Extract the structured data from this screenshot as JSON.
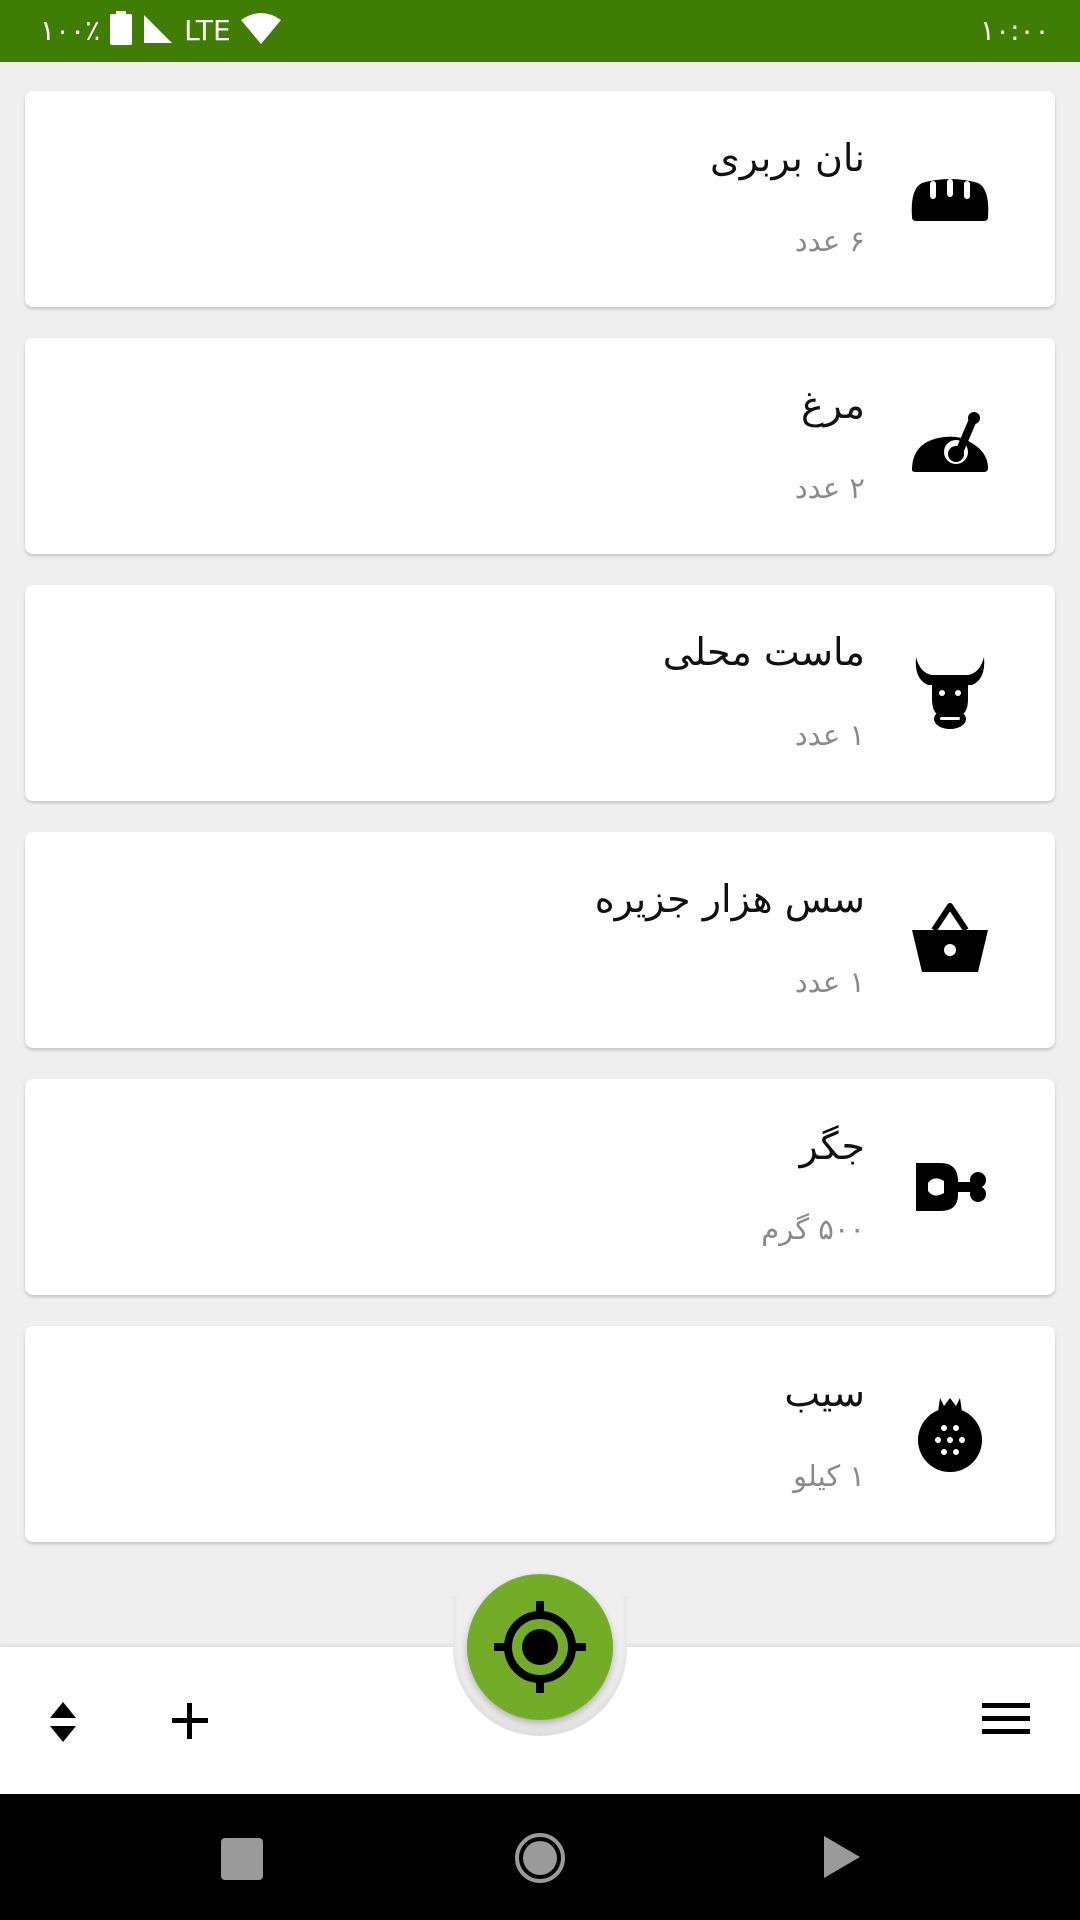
{
  "status_bar": {
    "time": "۱۰:۰۰",
    "battery_text": "۱۰۰٪",
    "network": "LTE",
    "icons": [
      "wifi-icon",
      "signal-icon",
      "battery-icon"
    ]
  },
  "items": [
    {
      "title": "نان بربری",
      "quantity": "۶ عدد",
      "icon": "bread-icon"
    },
    {
      "title": "مرغ",
      "quantity": "۲ عدد",
      "icon": "chicken-icon"
    },
    {
      "title": "ماست محلی",
      "quantity": "۱ عدد",
      "icon": "cow-icon"
    },
    {
      "title": "سس هزار جزیره",
      "quantity": "۱ عدد",
      "icon": "basket-icon"
    },
    {
      "title": "جگر",
      "quantity": "۵۰۰ گرم",
      "icon": "meat-icon"
    },
    {
      "title": "سیب",
      "quantity": "۱ کیلو",
      "icon": "fruit-icon"
    }
  ],
  "bottom_bar": {
    "left_icons": [
      "sort-icon",
      "add-icon"
    ],
    "center_icon": "locate-icon",
    "right_icon": "menu-icon"
  },
  "nav_bar": {
    "icons": [
      "recents-icon",
      "home-icon",
      "back-icon"
    ]
  },
  "colors": {
    "status_bar": "#3f7d05",
    "fab": "#73ad28",
    "background": "#efefef"
  }
}
